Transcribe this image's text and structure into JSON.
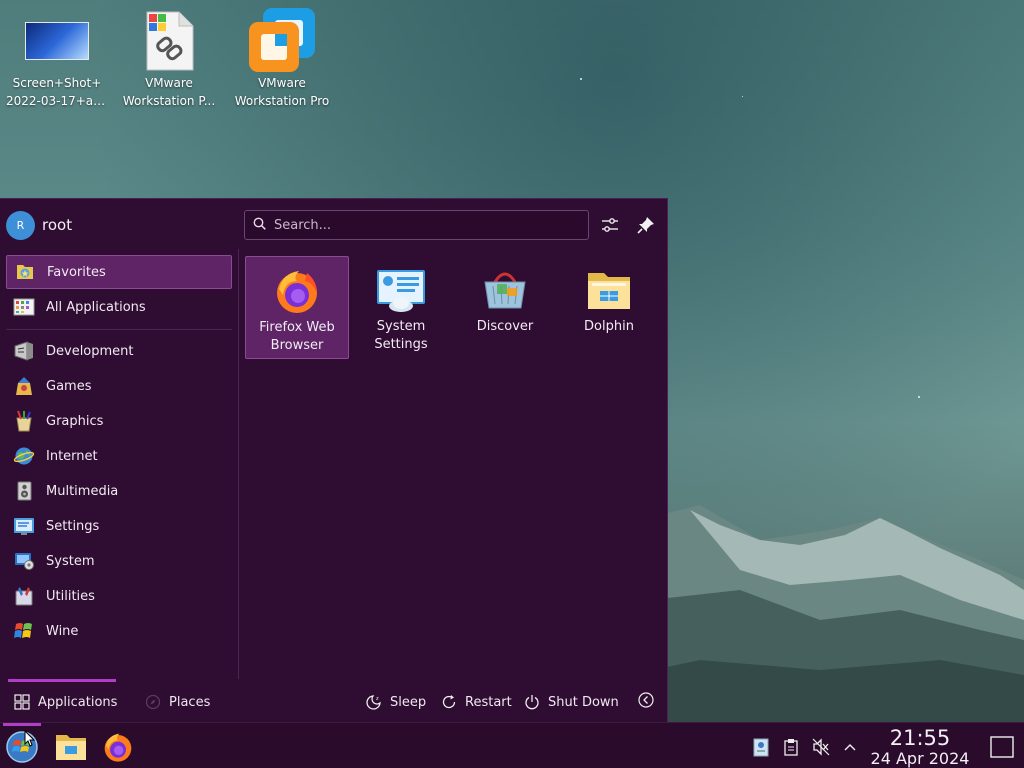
{
  "desktop": {
    "icons": [
      {
        "line1": "Screen+Shot+",
        "line2": "2022-03-17+at..."
      },
      {
        "line1": "VMware",
        "line2": "Workstation P..."
      },
      {
        "line1": "VMware",
        "line2": "Workstation Pro"
      }
    ]
  },
  "launcher": {
    "user": {
      "name": "root",
      "initial": "R"
    },
    "search": {
      "placeholder": "Search...",
      "value": ""
    },
    "categories": [
      {
        "label": "Favorites",
        "icon": "favorites-icon",
        "active": true
      },
      {
        "label": "All Applications",
        "icon": "all-applications-icon"
      },
      {
        "label": "Development",
        "icon": "development-icon"
      },
      {
        "label": "Games",
        "icon": "games-icon"
      },
      {
        "label": "Graphics",
        "icon": "graphics-icon"
      },
      {
        "label": "Internet",
        "icon": "internet-icon"
      },
      {
        "label": "Multimedia",
        "icon": "multimedia-icon"
      },
      {
        "label": "Settings",
        "icon": "settings-icon"
      },
      {
        "label": "System",
        "icon": "system-icon"
      },
      {
        "label": "Utilities",
        "icon": "utilities-icon"
      },
      {
        "label": "Wine",
        "icon": "wine-icon"
      }
    ],
    "favorites": [
      {
        "line1": "Firefox Web",
        "line2": "Browser",
        "icon": "firefox-icon",
        "active": true
      },
      {
        "line1": "System",
        "line2": "Settings",
        "icon": "system-settings-icon"
      },
      {
        "line1": "Discover",
        "line2": "",
        "icon": "discover-icon"
      },
      {
        "line1": "Dolphin",
        "line2": "",
        "icon": "dolphin-icon"
      }
    ],
    "bottom": {
      "applications_tab": "Applications",
      "places_tab": "Places",
      "sleep": "Sleep",
      "restart": "Restart",
      "shutdown": "Shut Down"
    }
  },
  "taskbar": {
    "clock": {
      "time": "21:55",
      "date": "24 Apr 2024"
    }
  },
  "colors": {
    "launcher_bg": "#2f0c31",
    "highlight_bg": "#5e2466",
    "accent": "#b13ec6",
    "taskbar_bg": "#2a0b2c"
  }
}
